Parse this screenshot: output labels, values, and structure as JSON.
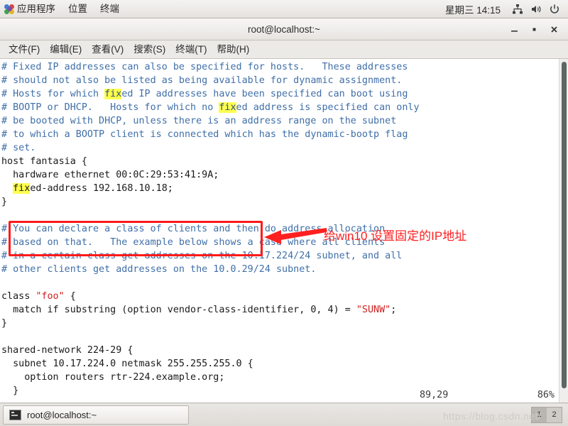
{
  "top_panel": {
    "apps_label": "应用程序",
    "places_label": "位置",
    "terminal_label": "终端",
    "clock": "星期三 14:15",
    "tray": [
      {
        "name": "network-icon"
      },
      {
        "name": "volume-icon"
      },
      {
        "name": "power-icon"
      }
    ]
  },
  "window": {
    "title": "root@localhost:~",
    "buttons": {
      "minimize": "–",
      "maximize": "■",
      "close": "✕"
    },
    "menu": [
      "文件(F)",
      "编辑(E)",
      "查看(V)",
      "搜索(S)",
      "终端(T)",
      "帮助(H)"
    ]
  },
  "terminal": {
    "lines": [
      [
        {
          "t": "# Fixed IP addresses can also be specified for hosts.   These addresses",
          "c": "cmt"
        }
      ],
      [
        {
          "t": "# should not also be listed as being available for dynamic assignment.",
          "c": "cmt"
        }
      ],
      [
        {
          "t": "# Hosts for which ",
          "c": "cmt"
        },
        {
          "t": "fix",
          "c": "hl"
        },
        {
          "t": "ed IP addresses have been specified can boot using",
          "c": "cmt"
        }
      ],
      [
        {
          "t": "# BOOTP or DHCP.   Hosts for which no ",
          "c": "cmt"
        },
        {
          "t": "fix",
          "c": "hl"
        },
        {
          "t": "ed address is specified can only",
          "c": "cmt"
        }
      ],
      [
        {
          "t": "# be booted with DHCP, unless there is an address range on the subnet",
          "c": "cmt"
        }
      ],
      [
        {
          "t": "# to which a BOOTP client is connected which has the dynamic-bootp flag",
          "c": "cmt"
        }
      ],
      [
        {
          "t": "# set.",
          "c": "cmt"
        }
      ],
      [
        {
          "t": "host fantasia {",
          "c": ""
        }
      ],
      [
        {
          "t": "  hardware ethernet 00:0C:29:53:41:9A;",
          "c": ""
        }
      ],
      [
        {
          "t": "  ",
          "c": ""
        },
        {
          "t": "fix",
          "c": "hl-dark"
        },
        {
          "t": "ed-address 192.168.10.18;",
          "c": ""
        }
      ],
      [
        {
          "t": "}",
          "c": ""
        }
      ],
      [
        {
          "t": "",
          "c": ""
        }
      ],
      [
        {
          "t": "# You can declare a class of clients and then do address allocation",
          "c": "cmt"
        }
      ],
      [
        {
          "t": "# based on that.   The example below shows a case where all clients",
          "c": "cmt"
        }
      ],
      [
        {
          "t": "# in a certain class get addresses on the 10.17.224/24 subnet, and all",
          "c": "cmt"
        }
      ],
      [
        {
          "t": "# other clients get addresses on the 10.0.29/24 subnet.",
          "c": "cmt"
        }
      ],
      [
        {
          "t": "",
          "c": ""
        }
      ],
      [
        {
          "t": "class ",
          "c": ""
        },
        {
          "t": "\"foo\"",
          "c": "red"
        },
        {
          "t": " {",
          "c": ""
        }
      ],
      [
        {
          "t": "  match if substring (option vendor-class-identifier, 0, 4) = ",
          "c": ""
        },
        {
          "t": "\"SUNW\"",
          "c": "red"
        },
        {
          "t": ";",
          "c": ""
        }
      ],
      [
        {
          "t": "}",
          "c": ""
        }
      ],
      [
        {
          "t": "",
          "c": ""
        }
      ],
      [
        {
          "t": "shared-network 224-29 {",
          "c": ""
        }
      ],
      [
        {
          "t": "  subnet 10.17.224.0 netmask 255.255.255.0 {",
          "c": ""
        }
      ],
      [
        {
          "t": "    option routers rtr-224.example.org;",
          "c": ""
        }
      ],
      [
        {
          "t": "  }",
          "c": ""
        }
      ]
    ],
    "status": {
      "position": "89,29",
      "percent": "86%"
    }
  },
  "annotation": {
    "text": "给win10 设置固定的IP地址",
    "color": "#ff2020"
  },
  "taskbar": {
    "task_label": "root@localhost:~",
    "watermark": "https://blog.csdn.net/",
    "workspaces": [
      "1",
      "2"
    ]
  }
}
